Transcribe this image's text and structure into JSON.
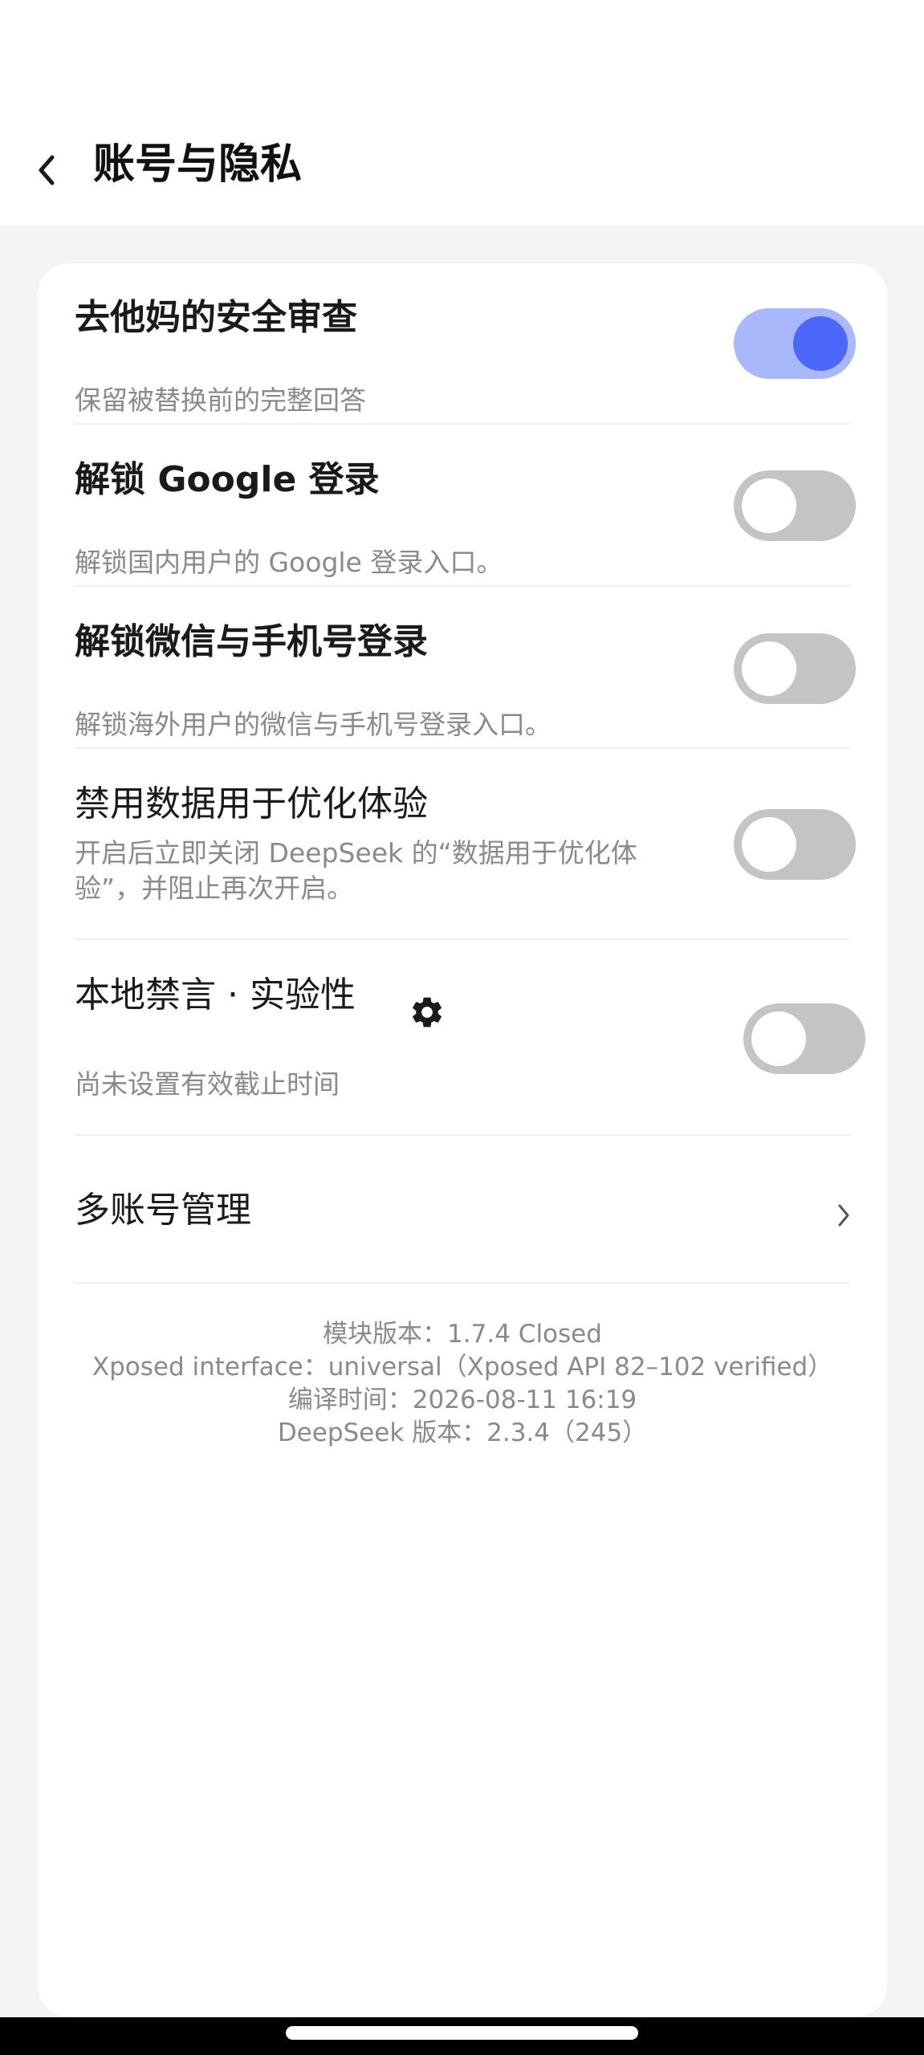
{
  "header": {
    "title": "账号与隐私",
    "back_icon": "chevron-left-icon"
  },
  "settings": [
    {
      "title": "去他妈的安全审查",
      "subtitle": "保留被替换前的完整回答",
      "enabled": true
    },
    {
      "title": "解锁 Google 登录",
      "subtitle": "解锁国内用户的 Google 登录入口。",
      "enabled": false
    },
    {
      "title": "解锁微信与手机号登录",
      "subtitle": "解锁海外用户的微信与手机号登录入口。",
      "enabled": false
    },
    {
      "title": "禁用数据用于优化体验",
      "subtitle_line1": "开启后立即关闭 DeepSeek 的“数据用于优化体",
      "subtitle_line2": "验”，并阻止再次开启。",
      "enabled": false
    },
    {
      "title": "本地禁言 · 实验性",
      "subtitle": "尚未设置有效截止时间",
      "enabled": false,
      "icon": "gear-icon"
    }
  ],
  "multi_account": {
    "label": "多账号管理",
    "icon": "chevron-right-icon"
  },
  "version_info": {
    "module": "模块版本：1.7.4 Closed",
    "xposed": "Xposed interface：universal（Xposed API 82–102 verified）",
    "build_time": "编译时间：2026-08-11 16:19",
    "deepseek": "DeepSeek 版本：2.3.4（245）"
  },
  "colors": {
    "accent": "#4b68fb",
    "accent_track": "#a9b7fb",
    "toggle_off": "#c4c4c4",
    "background": "#f3f4f6"
  }
}
